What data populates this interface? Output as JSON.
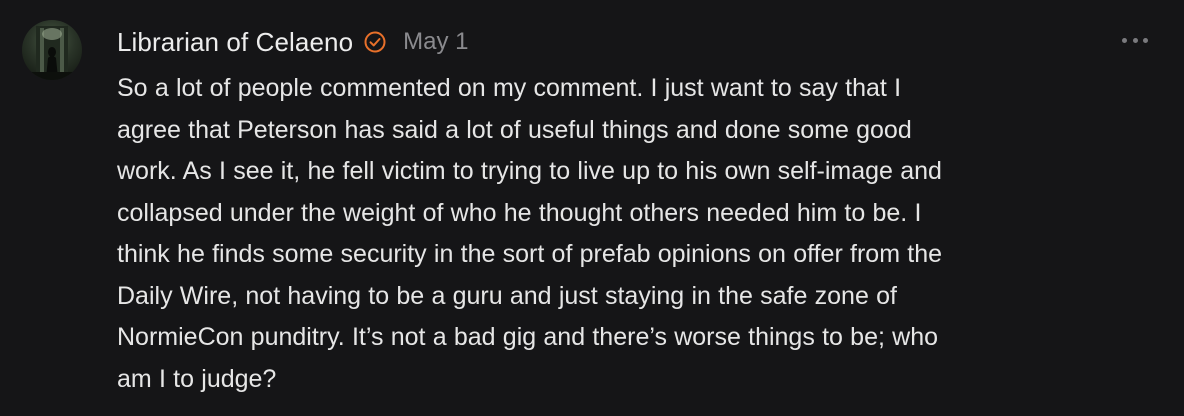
{
  "comment": {
    "author": "Librarian of Celaeno",
    "date": "May 1",
    "verified_badge_icon": "verified-check-icon",
    "more_icon": "more-horizontal-icon",
    "avatar_icon": "avatar-image",
    "body_lines": [
      "So a lot of people commented on my comment. I just want to say that I",
      "agree that Peterson has said a lot of useful things and done some good",
      "work. As I see it, he fell victim to trying to live up to his own self-image and",
      "collapsed under the weight of who he thought others needed him to be. I",
      "think he finds some security in the sort of prefab opinions on offer from the",
      "Daily Wire, not having to be a guru and just staying in the safe zone of",
      "NormieCon punditry. It’s not a bad gig and there’s worse things to be; who",
      "am I to judge?"
    ]
  },
  "colors": {
    "background": "#151517",
    "text": "#e6e6e6",
    "muted": "#8a8a8e",
    "badge": "#e8702a"
  }
}
